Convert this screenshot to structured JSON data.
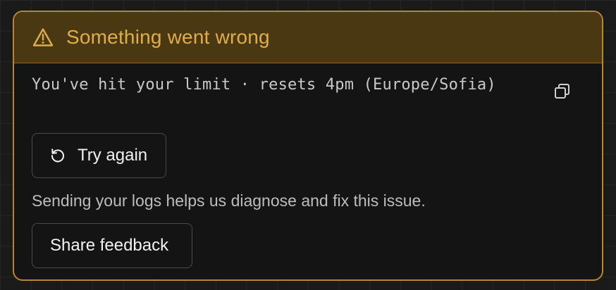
{
  "alert": {
    "title": "Something went wrong",
    "icon": "warning-triangle-icon",
    "message": "You've hit your limit · resets 4pm (Europe/Sofia)",
    "copy_icon": "copy-icon",
    "hint": "Sending your logs helps us diagnose and fix this issue."
  },
  "actions": {
    "try_again_label": "Try again",
    "try_again_icon": "retry-icon",
    "share_feedback_label": "Share feedback"
  },
  "colors": {
    "accent": "#e0ad4b",
    "border": "#b8862e",
    "header_bg": "#4a3812",
    "card_bg": "#141414"
  }
}
